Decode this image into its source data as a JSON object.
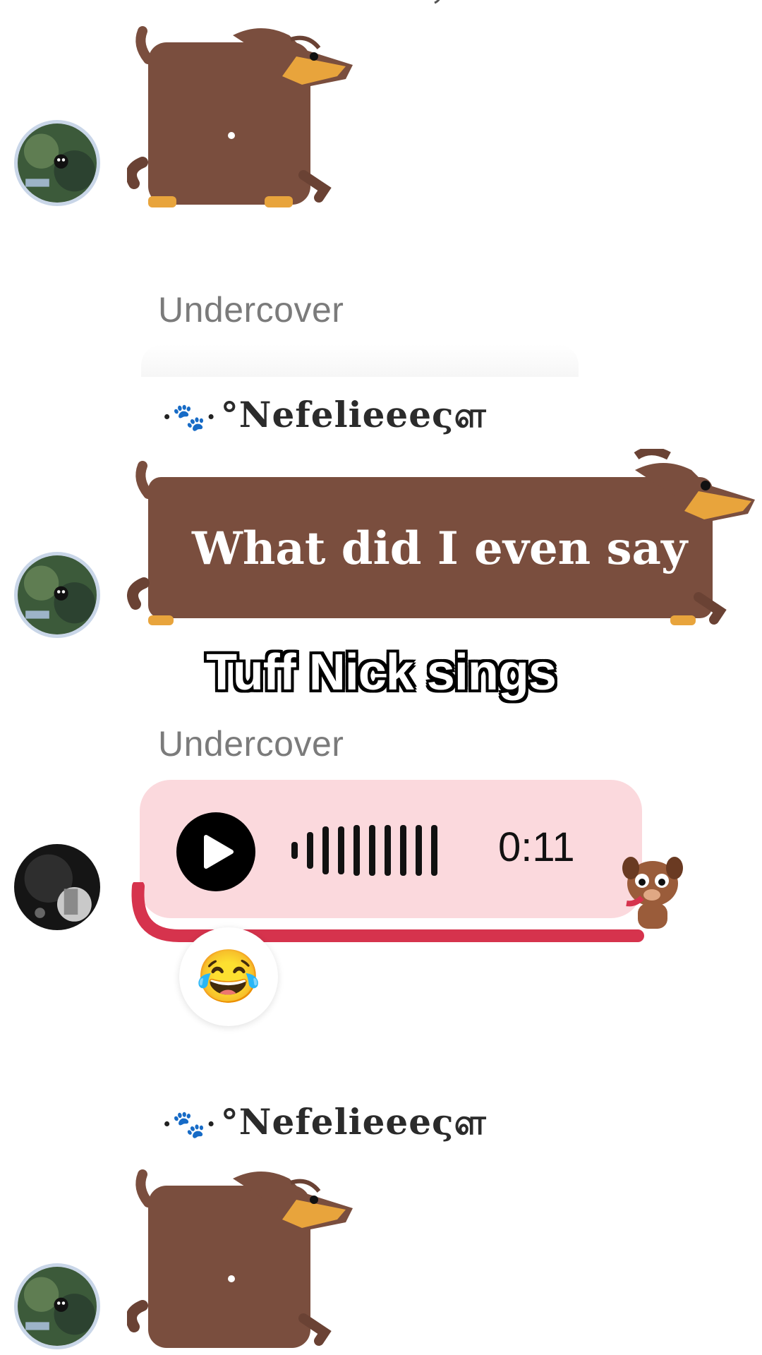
{
  "caption": "Tuff Nick sings",
  "messages": [
    {
      "kind": "sticker",
      "sticker": "dachshund-square"
    },
    {
      "sender": "Undercover"
    },
    {
      "sender": "°Nefelieeeςள",
      "paw_decoration": "·🐾·",
      "text": "What did I even say"
    },
    {
      "sender": "Undercover",
      "kind": "voice",
      "duration": "0:11",
      "reaction": "😂"
    },
    {
      "sender": "°Nefelieeeςள",
      "paw_decoration": "·🐾·",
      "kind": "sticker",
      "sticker": "dachshund-square"
    }
  ],
  "colors": {
    "dog_body": "#7a4e3e",
    "dog_snout": "#e8a43c",
    "voice_bubble": "#fbd9dd",
    "leash": "#d6334d"
  }
}
